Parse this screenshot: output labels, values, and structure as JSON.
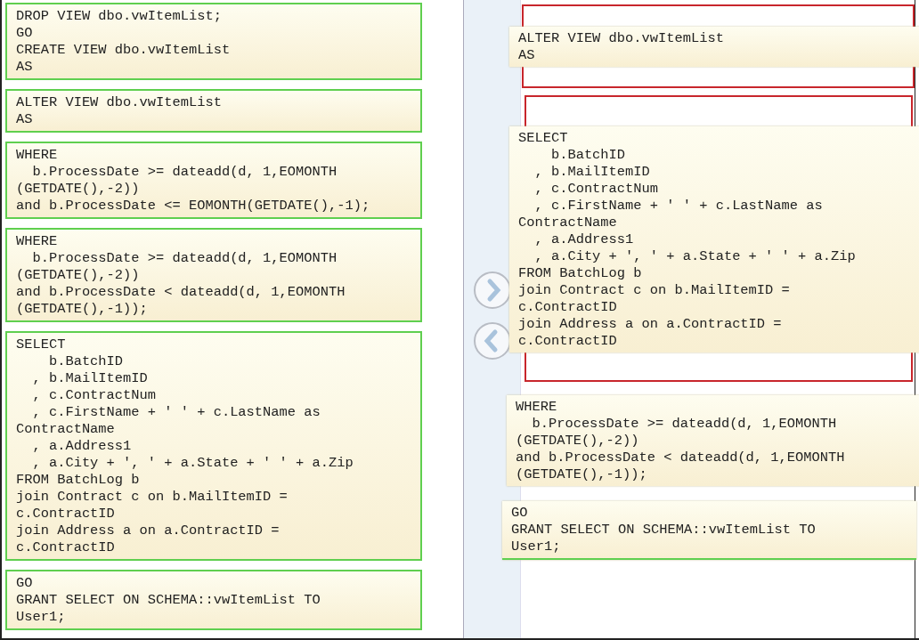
{
  "source_blocks": [
    {
      "code": "DROP VIEW dbo.vwItemList;\nGO\nCREATE VIEW dbo.vwItemList\nAS"
    },
    {
      "code": "ALTER VIEW dbo.vwItemList\nAS"
    },
    {
      "code": "WHERE\n  b.ProcessDate >= dateadd(d, 1,EOMONTH\n(GETDATE(),-2))\nand b.ProcessDate <= EOMONTH(GETDATE(),-1);"
    },
    {
      "code": "WHERE\n  b.ProcessDate >= dateadd(d, 1,EOMONTH\n(GETDATE(),-2))\nand b.ProcessDate < dateadd(d, 1,EOMONTH\n(GETDATE(),-1));"
    },
    {
      "code": "SELECT\n    b.BatchID\n  , b.MailItemID\n  , c.ContractNum\n  , c.FirstName + ' ' + c.LastName as\nContractName\n  , a.Address1\n  , a.City + ', ' + a.State + ' ' + a.Zip\nFROM BatchLog b\njoin Contract c on b.MailItemID =\nc.ContractID\njoin Address a on a.ContractID =\nc.ContractID"
    },
    {
      "code": "GO\nGRANT SELECT ON SCHEMA::vwItemList TO\nUser1;"
    }
  ],
  "answer_blocks": [
    {
      "code": "ALTER VIEW dbo.vwItemList\nAS"
    },
    {
      "code": "SELECT\n    b.BatchID\n  , b.MailItemID\n  , c.ContractNum\n  , c.FirstName + ' ' + c.LastName as\nContractName\n  , a.Address1\n  , a.City + ', ' + a.State + ' ' + a.Zip\nFROM BatchLog b\njoin Contract c on b.MailItemID =\nc.ContractID\njoin Address a on a.ContractID =\nc.ContractID"
    },
    {
      "code": "WHERE\n  b.ProcessDate >= dateadd(d, 1,EOMONTH\n(GETDATE(),-2))\nand b.ProcessDate < dateadd(d, 1,EOMONTH\n(GETDATE(),-1));"
    },
    {
      "code": "GO\nGRANT SELECT ON SCHEMA::vwItemList TO\nUser1;"
    }
  ]
}
